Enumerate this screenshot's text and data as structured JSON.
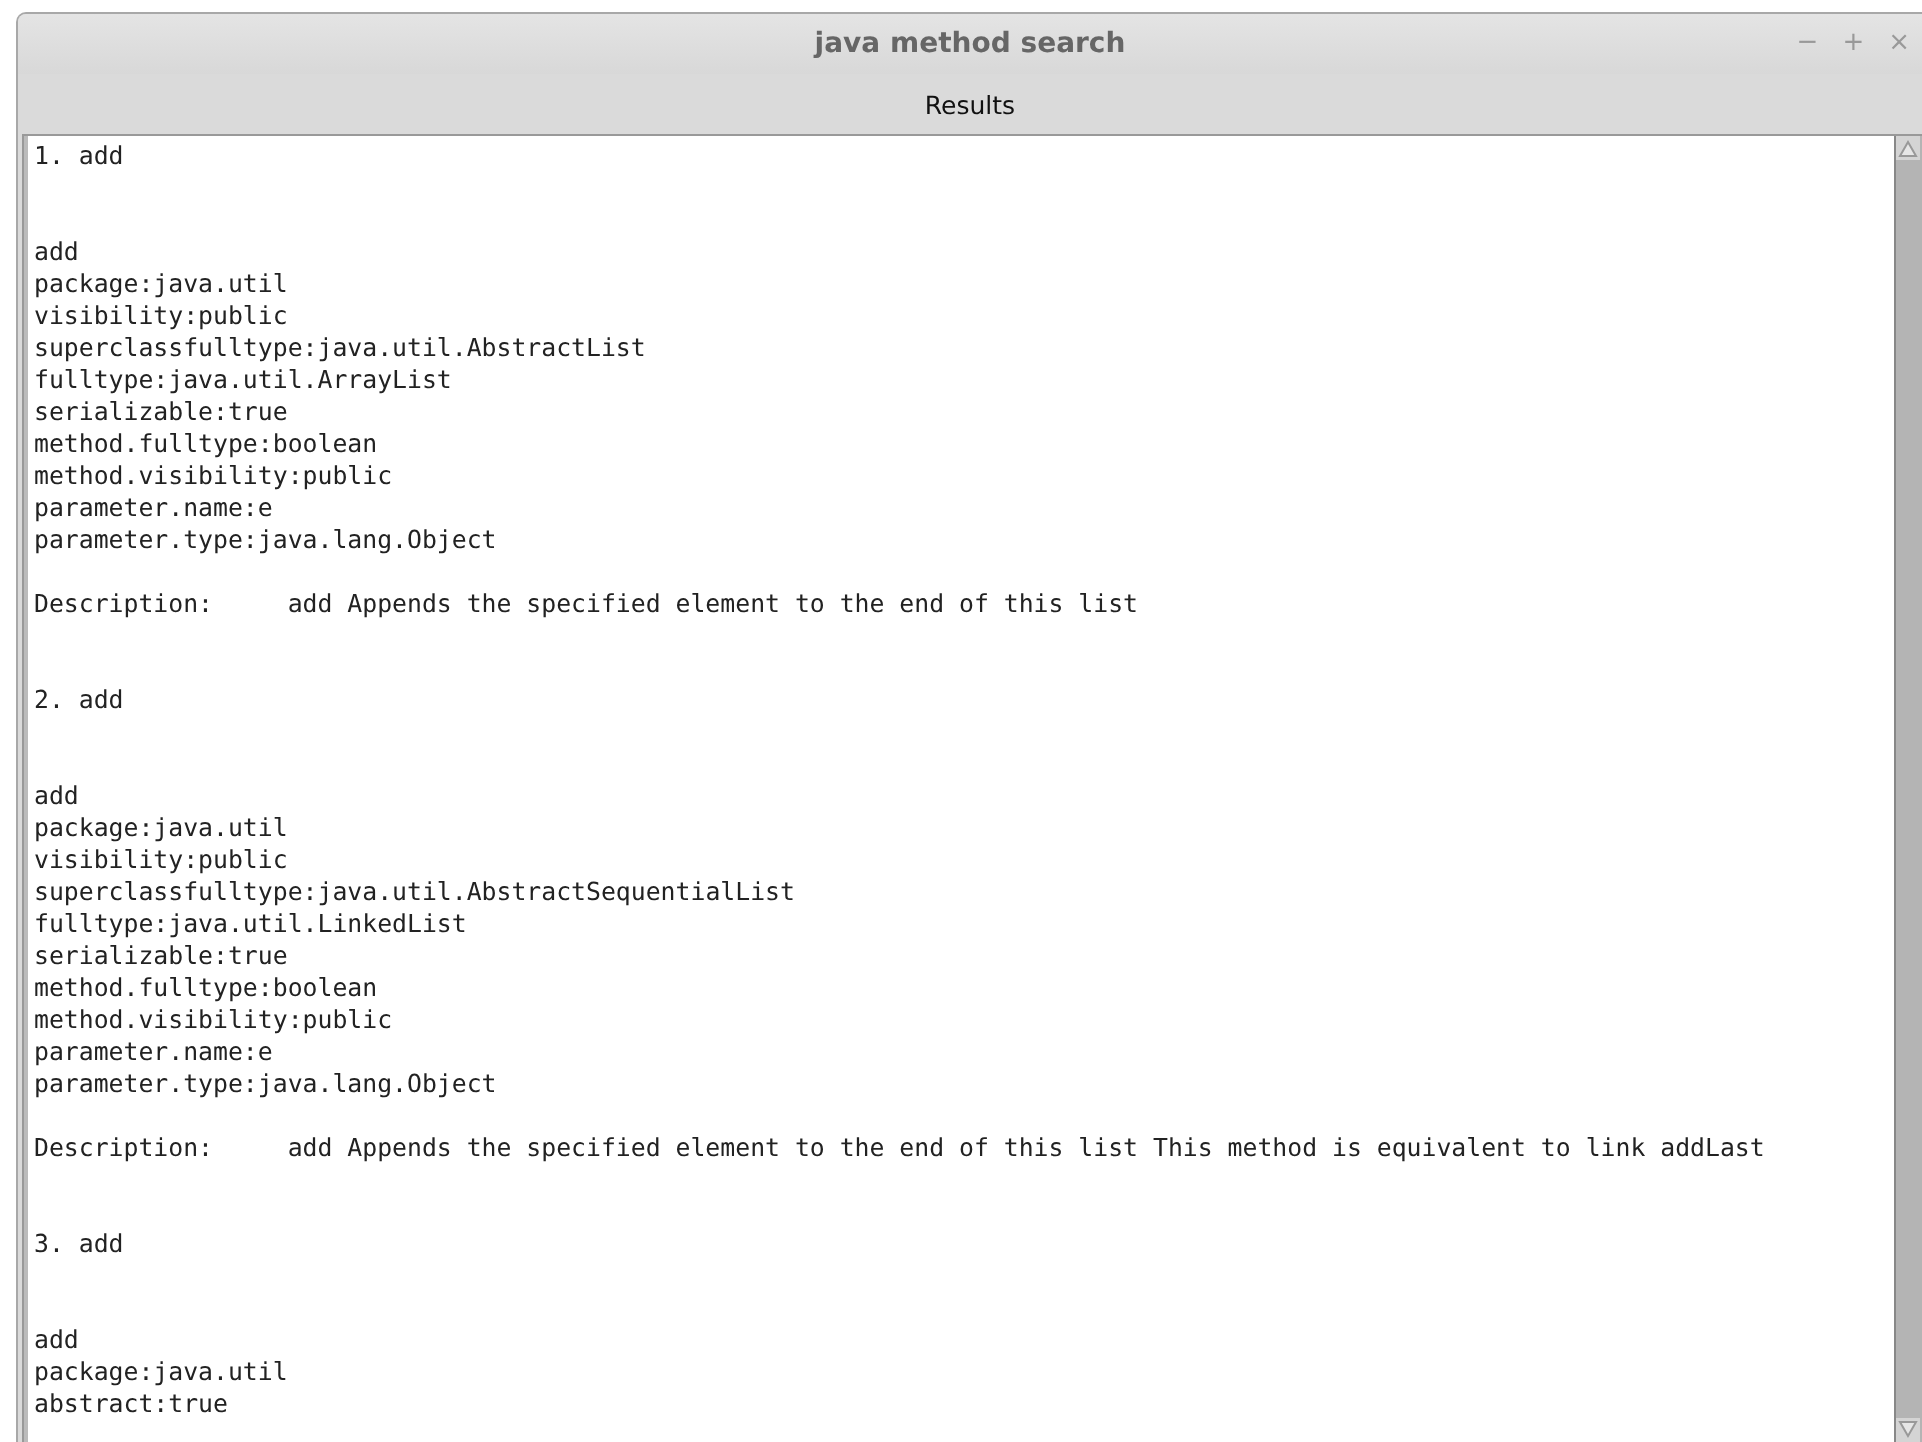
{
  "window": {
    "title": "java method search",
    "controls": [
      "−",
      "+",
      "×"
    ]
  },
  "header": "Results",
  "results": [
    {
      "heading": "1. add",
      "lines": [
        "add",
        "package:java.util",
        "visibility:public",
        "superclassfulltype:java.util.AbstractList",
        "fulltype:java.util.ArrayList",
        "serializable:true",
        "method.fulltype:boolean",
        "method.visibility:public",
        "parameter.name:e",
        "parameter.type:java.lang.Object"
      ],
      "description_label": "Description:",
      "description": "add Appends the specified element to the end of this list"
    },
    {
      "heading": "2. add",
      "lines": [
        "add",
        "package:java.util",
        "visibility:public",
        "superclassfulltype:java.util.AbstractSequentialList",
        "fulltype:java.util.LinkedList",
        "serializable:true",
        "method.fulltype:boolean",
        "method.visibility:public",
        "parameter.name:e",
        "parameter.type:java.lang.Object"
      ],
      "description_label": "Description:",
      "description": "add Appends the specified element to the end of this list This method is equivalent to link addLast"
    },
    {
      "heading": "3. add",
      "lines": [
        "add",
        "package:java.util",
        "abstract:true"
      ]
    }
  ]
}
